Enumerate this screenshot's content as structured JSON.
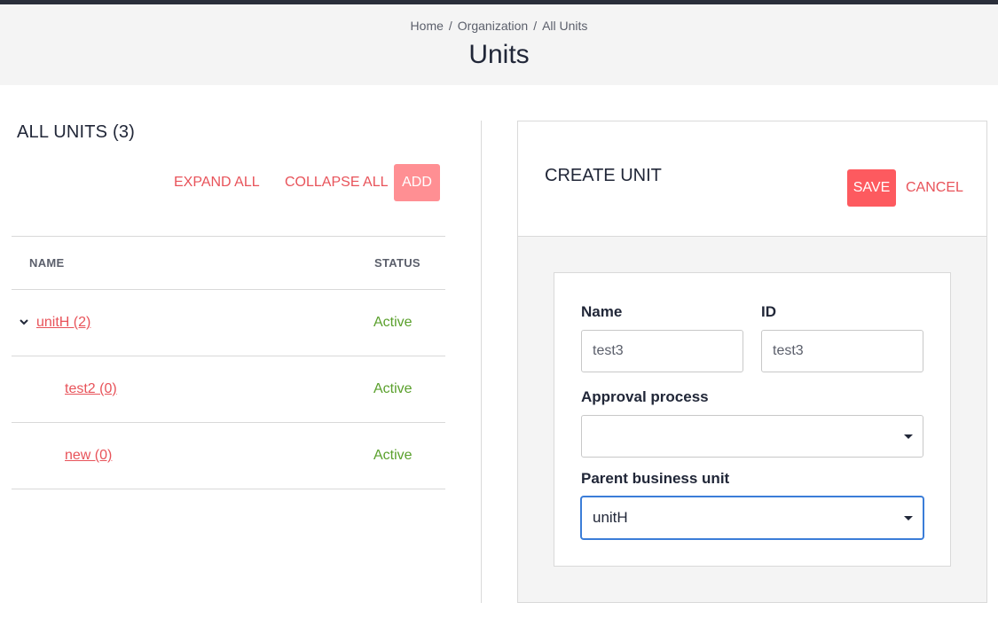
{
  "breadcrumb": {
    "items": [
      "Home",
      "Organization",
      "All Units"
    ],
    "separator": "/"
  },
  "page": {
    "title": "Units"
  },
  "left": {
    "heading": "ALL UNITS (3)",
    "expand_all_label": "EXPAND ALL",
    "collapse_all_label": "COLLAPSE ALL",
    "add_label": "ADD",
    "table": {
      "columns": [
        "NAME",
        "STATUS"
      ],
      "rows": [
        {
          "name": "unitH (2)",
          "status": "Active",
          "expanded": true,
          "level": 0
        },
        {
          "name": "test2 (0)",
          "status": "Active",
          "level": 1
        },
        {
          "name": "new (0)",
          "status": "Active",
          "level": 1
        }
      ]
    }
  },
  "right": {
    "title": "CREATE UNIT",
    "save_label": "SAVE",
    "cancel_label": "CANCEL",
    "form": {
      "name_label": "Name",
      "name_value": "test3",
      "id_label": "ID",
      "id_value": "test3",
      "approval_label": "Approval process",
      "approval_value": "",
      "parent_label": "Parent business unit",
      "parent_value": "unitH"
    }
  },
  "colors": {
    "accent": "#fd5a5f",
    "link": "#e8535a",
    "status_active": "#5aa02c",
    "focus": "#3b7dd8"
  }
}
